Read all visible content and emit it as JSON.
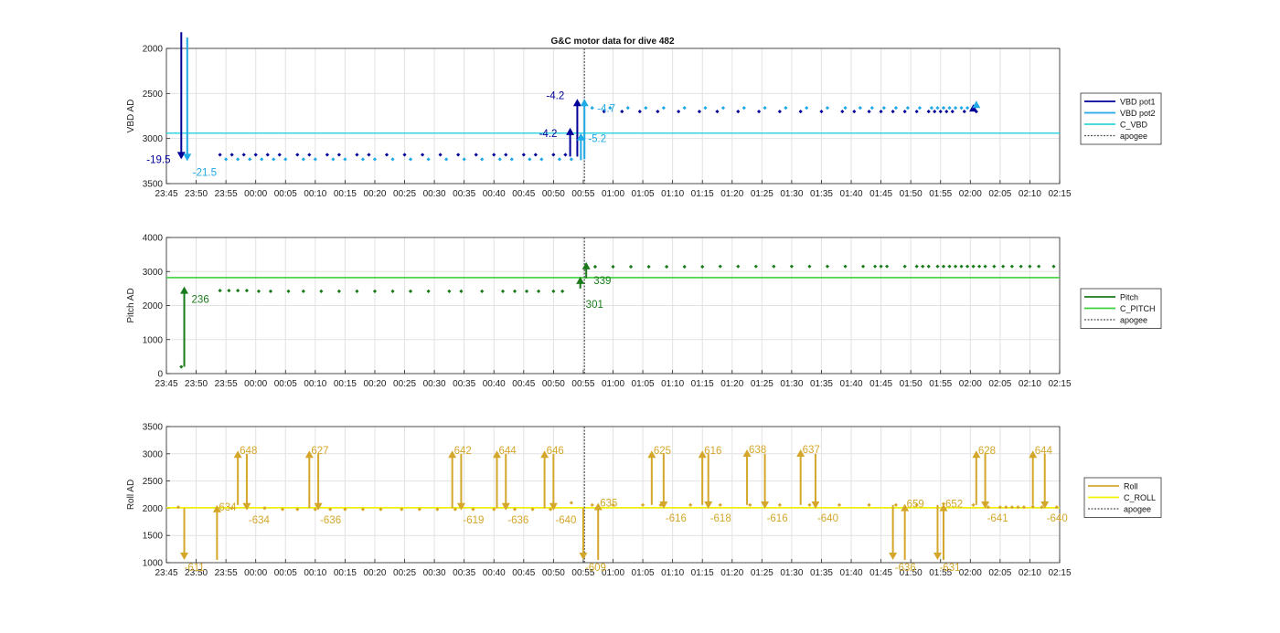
{
  "figure": {
    "title": "G&C motor data for dive 482"
  },
  "colors": {
    "vbd_pot1": "#000099",
    "vbd_pot2": "#1fa9e6",
    "c_vbd": "#33d6e0",
    "pitch": "#1a7a1a",
    "c_pitch": "#3ed13e",
    "roll": "#d4a62a",
    "c_roll": "#f2f200",
    "apogee": "#555555",
    "grid": "#e2e2e2",
    "axis": "#262626"
  },
  "chart_data": [
    {
      "type": "scatter",
      "title": "G&C motor data for dive 482",
      "ylabel": "VBD AD",
      "ylim": [
        2000,
        3500
      ],
      "y_reversed": true,
      "y_ticks": [
        "2000",
        "2500",
        "3000",
        "3500"
      ],
      "x_ticks": [
        "23:45",
        "23:50",
        "23:55",
        "00:00",
        "00:05",
        "00:10",
        "00:15",
        "00:20",
        "00:25",
        "00:30",
        "00:35",
        "00:40",
        "00:45",
        "00:50",
        "00:55",
        "01:00",
        "01:05",
        "01:10",
        "01:15",
        "01:20",
        "01:25",
        "01:30",
        "01:35",
        "01:40",
        "01:45",
        "01:50",
        "01:55",
        "02:00",
        "02:05",
        "02:10",
        "02:15"
      ],
      "xlim_minutes": [
        0,
        150
      ],
      "grid": true,
      "legend_position": "right",
      "legend": [
        "VBD pot1",
        "VBD pot2",
        "C_VBD",
        "apogee"
      ],
      "c_value": 2940,
      "apogee_minutes": 70.2,
      "series": [
        {
          "name": "VBD pot1",
          "color_key": "vbd_pot1",
          "x": [
            9,
            11,
            13,
            15,
            17,
            19,
            22,
            24,
            27,
            29,
            32,
            34,
            37,
            40,
            43,
            46,
            49,
            52,
            55,
            57,
            60,
            62,
            65,
            67,
            73.5,
            76.5,
            79.5,
            82.5,
            86,
            89.5,
            92.5,
            96,
            99.5,
            103,
            106.5,
            110,
            113.5,
            115.5,
            118,
            120,
            122,
            124,
            126,
            128,
            129,
            130,
            131,
            132,
            134,
            136
          ],
          "y": [
            3180,
            3180,
            3180,
            3180,
            3180,
            3180,
            3180,
            3180,
            3180,
            3180,
            3180,
            3180,
            3180,
            3180,
            3180,
            3180,
            3180,
            3180,
            3180,
            3180,
            3180,
            3180,
            3180,
            3180,
            2700,
            2700,
            2700,
            2700,
            2700,
            2700,
            2700,
            2700,
            2700,
            2700,
            2700,
            2700,
            2700,
            2700,
            2700,
            2700,
            2700,
            2700,
            2700,
            2700,
            2700,
            2700,
            2700,
            2700,
            2700,
            2700
          ]
        },
        {
          "name": "VBD pot2",
          "color_key": "vbd_pot2",
          "x": [
            10,
            12,
            14,
            16,
            18,
            20,
            23,
            25,
            28,
            30,
            33,
            35,
            38,
            41,
            44,
            47,
            50,
            53,
            56,
            58,
            61,
            63,
            66,
            68,
            71.5,
            74.5,
            77.5,
            80.5,
            83.5,
            87,
            90.5,
            93.5,
            97,
            100.5,
            104,
            107.5,
            111,
            114,
            116.5,
            118.5,
            120.5,
            122.5,
            124.5,
            126.5,
            128.5,
            129.5,
            130.5,
            131.5,
            132.5,
            133.5,
            134.5
          ],
          "y": [
            3230,
            3230,
            3230,
            3230,
            3230,
            3230,
            3230,
            3230,
            3230,
            3230,
            3230,
            3230,
            3230,
            3230,
            3230,
            3230,
            3230,
            3230,
            3230,
            3230,
            3230,
            3230,
            3230,
            3230,
            2660,
            2660,
            2660,
            2660,
            2660,
            2660,
            2660,
            2660,
            2660,
            2660,
            2660,
            2660,
            2660,
            2660,
            2660,
            2660,
            2660,
            2660,
            2660,
            2660,
            2660,
            2660,
            2660,
            2660,
            2660,
            2660,
            2660
          ]
        }
      ],
      "arrows": [
        {
          "color_key": "vbd_pot1",
          "x": 2.5,
          "y_from": 1820,
          "y_to": 3230,
          "label": "-19.5",
          "label_dx": -38,
          "label_dy": 4
        },
        {
          "color_key": "vbd_pot2",
          "x": 3.5,
          "y_from": 1880,
          "y_to": 3250,
          "label": "-21.5",
          "label_dx": 6,
          "label_dy": 16
        },
        {
          "color_key": "vbd_pot1",
          "x": 69.0,
          "y_from": 3200,
          "y_to": 2560,
          "label": "-4.2",
          "label_dx": -34,
          "label_dy": 0
        },
        {
          "color_key": "vbd_pot1",
          "x": 67.8,
          "y_from": 3200,
          "y_to": 2880,
          "label": "-4.2",
          "label_dx": -34,
          "label_dy": 10
        },
        {
          "color_key": "vbd_pot2",
          "x": 70.2,
          "y_from": 3230,
          "y_to": 2560,
          "label": "-4.7",
          "label_dx": 14,
          "label_dy": 14
        },
        {
          "color_key": "vbd_pot2",
          "x": 69.6,
          "y_from": 3240,
          "y_to": 2940,
          "label": "-5.2",
          "label_dx": 8,
          "label_dy": 10
        },
        {
          "color_key": "vbd_pot1",
          "x": 135.5,
          "y_from": 2680,
          "y_to": 2620,
          "label": "",
          "label_dx": 0,
          "label_dy": 0
        },
        {
          "color_key": "vbd_pot2",
          "x": 136.0,
          "y_from": 2640,
          "y_to": 2580,
          "label": "",
          "label_dx": 0,
          "label_dy": 0
        }
      ]
    },
    {
      "type": "scatter",
      "ylabel": "Pitch AD",
      "ylim": [
        0,
        4000
      ],
      "y_reversed": false,
      "y_ticks": [
        "0",
        "1000",
        "2000",
        "3000",
        "4000"
      ],
      "x_ticks": [
        "23:45",
        "23:50",
        "23:55",
        "00:00",
        "00:05",
        "00:10",
        "00:15",
        "00:20",
        "00:25",
        "00:30",
        "00:35",
        "00:40",
        "00:45",
        "00:50",
        "00:55",
        "01:00",
        "01:05",
        "01:10",
        "01:15",
        "01:20",
        "01:25",
        "01:30",
        "01:35",
        "01:40",
        "01:45",
        "01:50",
        "01:55",
        "02:00",
        "02:05",
        "02:10",
        "02:15"
      ],
      "xlim_minutes": [
        0,
        150
      ],
      "grid": true,
      "legend_position": "right",
      "legend": [
        "Pitch",
        "C_PITCH",
        "apogee"
      ],
      "c_value": 2820,
      "apogee_minutes": 70.2,
      "series": [
        {
          "name": "Pitch",
          "color_key": "pitch",
          "x": [
            2.5,
            9,
            10.5,
            12,
            13.5,
            15.5,
            17.5,
            20.5,
            23,
            26,
            29,
            32,
            35,
            38,
            41,
            44,
            47.5,
            49.5,
            53,
            56.5,
            58.5,
            60.5,
            62.5,
            65,
            66.5,
            72,
            75,
            78,
            81,
            84,
            87,
            90,
            93,
            96,
            99,
            102,
            105,
            108,
            111,
            114,
            117,
            119,
            120,
            121,
            124,
            126,
            127,
            128,
            129.5,
            130.5,
            131.5,
            132.5,
            133.5,
            134.5,
            135.5,
            136.5,
            137.5,
            139,
            140.5,
            142,
            143.5,
            145,
            146.5,
            149
          ],
          "y": [
            200,
            2440,
            2440,
            2440,
            2440,
            2420,
            2420,
            2420,
            2420,
            2420,
            2420,
            2420,
            2420,
            2420,
            2420,
            2420,
            2420,
            2420,
            2420,
            2420,
            2420,
            2420,
            2420,
            2420,
            2420,
            3140,
            3140,
            3140,
            3140,
            3140,
            3140,
            3140,
            3150,
            3150,
            3150,
            3150,
            3150,
            3150,
            3150,
            3150,
            3150,
            3150,
            3150,
            3150,
            3150,
            3150,
            3150,
            3150,
            3150,
            3150,
            3150,
            3150,
            3150,
            3150,
            3150,
            3150,
            3150,
            3150,
            3150,
            3150,
            3150,
            3150,
            3150,
            3150
          ]
        }
      ],
      "arrows": [
        {
          "color_key": "pitch",
          "x": 3.0,
          "y_from": 200,
          "y_to": 2560,
          "label": "236",
          "label_dx": 8,
          "label_dy": 18
        },
        {
          "color_key": "pitch",
          "x": 69.5,
          "y_from": 2500,
          "y_to": 2850,
          "label": "301",
          "label_dx": 6,
          "label_dy": 34
        },
        {
          "color_key": "pitch",
          "x": 70.5,
          "y_from": 2800,
          "y_to": 3280,
          "label": "339",
          "label_dx": 8,
          "label_dy": 24
        }
      ]
    },
    {
      "type": "scatter",
      "ylabel": "Roll AD",
      "ylim": [
        1000,
        3500
      ],
      "y_reversed": false,
      "y_ticks": [
        "1000",
        "1500",
        "2000",
        "2500",
        "3000",
        "3500"
      ],
      "x_ticks": [
        "23:45",
        "23:50",
        "23:55",
        "00:00",
        "00:05",
        "00:10",
        "00:15",
        "00:20",
        "00:25",
        "00:30",
        "00:35",
        "00:40",
        "00:45",
        "00:50",
        "00:55",
        "01:00",
        "01:05",
        "01:10",
        "01:15",
        "01:20",
        "01:25",
        "01:30",
        "01:35",
        "01:40",
        "01:45",
        "01:50",
        "01:55",
        "02:00",
        "02:05",
        "02:10",
        "02:15"
      ],
      "xlim_minutes": [
        0,
        150
      ],
      "grid": true,
      "legend_position": "right",
      "legend": [
        "Roll",
        "C_ROLL",
        "apogee"
      ],
      "c_value": 2010,
      "apogee_minutes": 70.2,
      "series": [
        {
          "name": "Roll",
          "color_key": "roll",
          "x": [
            2,
            11,
            16.5,
            19.5,
            22,
            25,
            27.5,
            30,
            33,
            36,
            39.5,
            42.5,
            45.5,
            48.5,
            51.5,
            55,
            58.5,
            61.5,
            64.5,
            68,
            71.5,
            75,
            80,
            83,
            88,
            93,
            98,
            103,
            108,
            113,
            118,
            122.5,
            126,
            130.5,
            135.5,
            138,
            140,
            141,
            142,
            143,
            144,
            145.5,
            147,
            149.5
          ],
          "y": [
            2020,
            2000,
            2000,
            1980,
            1980,
            1980,
            1980,
            1980,
            1980,
            1980,
            1980,
            1980,
            1980,
            1980,
            1980,
            1980,
            1980,
            1980,
            1980,
            2100,
            2060,
            2060,
            2060,
            2060,
            2060,
            2060,
            2060,
            2060,
            2060,
            2060,
            2060,
            2060,
            2060,
            2080,
            2060,
            2020,
            2020,
            2020,
            2020,
            2020,
            2020,
            2030,
            2020,
            2020
          ]
        }
      ],
      "arrows": [
        {
          "color_key": "roll",
          "x": 3.0,
          "y_from": 2000,
          "y_to": 1050,
          "label": "-611",
          "label_dx": 0,
          "label_dy": 12
        },
        {
          "color_key": "roll",
          "x": 8.5,
          "y_from": 1050,
          "y_to": 2060,
          "label": "634",
          "label_dx": 2,
          "label_dy": 6
        },
        {
          "color_key": "roll",
          "x": 12.0,
          "y_from": 2060,
          "y_to": 3060,
          "label": "648",
          "label_dx": 2,
          "label_dy": 4
        },
        {
          "color_key": "roll",
          "x": 13.5,
          "y_from": 3000,
          "y_to": 1960,
          "label": "-634",
          "label_dx": 2,
          "label_dy": 14
        },
        {
          "color_key": "roll",
          "x": 24.0,
          "y_from": 2000,
          "y_to": 3060,
          "label": "627",
          "label_dx": 2,
          "label_dy": 4
        },
        {
          "color_key": "roll",
          "x": 25.5,
          "y_from": 3000,
          "y_to": 1960,
          "label": "-636",
          "label_dx": 2,
          "label_dy": 14
        },
        {
          "color_key": "roll",
          "x": 48.0,
          "y_from": 2000,
          "y_to": 3060,
          "label": "642",
          "label_dx": 2,
          "label_dy": 4
        },
        {
          "color_key": "roll",
          "x": 49.5,
          "y_from": 3000,
          "y_to": 1960,
          "label": "-619",
          "label_dx": 2,
          "label_dy": 14
        },
        {
          "color_key": "roll",
          "x": 55.5,
          "y_from": 2000,
          "y_to": 3060,
          "label": "644",
          "label_dx": 2,
          "label_dy": 4
        },
        {
          "color_key": "roll",
          "x": 57.0,
          "y_from": 3000,
          "y_to": 1960,
          "label": "-636",
          "label_dx": 2,
          "label_dy": 14
        },
        {
          "color_key": "roll",
          "x": 63.5,
          "y_from": 2000,
          "y_to": 3060,
          "label": "646",
          "label_dx": 2,
          "label_dy": 4
        },
        {
          "color_key": "roll",
          "x": 65.0,
          "y_from": 3000,
          "y_to": 1960,
          "label": "-640",
          "label_dx": 2,
          "label_dy": 14
        },
        {
          "color_key": "roll",
          "x": 70.0,
          "y_from": 2000,
          "y_to": 1050,
          "label": "-609",
          "label_dx": 2,
          "label_dy": 12
        },
        {
          "color_key": "roll",
          "x": 72.5,
          "y_from": 1050,
          "y_to": 2100,
          "label": "635",
          "label_dx": 2,
          "label_dy": 4
        },
        {
          "color_key": "roll",
          "x": 81.5,
          "y_from": 2060,
          "y_to": 3060,
          "label": "625",
          "label_dx": 2,
          "label_dy": 4
        },
        {
          "color_key": "roll",
          "x": 83.5,
          "y_from": 3000,
          "y_to": 1990,
          "label": "-616",
          "label_dx": 2,
          "label_dy": 14
        },
        {
          "color_key": "roll",
          "x": 90.0,
          "y_from": 2060,
          "y_to": 3060,
          "label": "616",
          "label_dx": 2,
          "label_dy": 4
        },
        {
          "color_key": "roll",
          "x": 91.0,
          "y_from": 3000,
          "y_to": 1990,
          "label": "-618",
          "label_dx": 2,
          "label_dy": 14
        },
        {
          "color_key": "roll",
          "x": 97.5,
          "y_from": 2060,
          "y_to": 3080,
          "label": "638",
          "label_dx": 2,
          "label_dy": 4
        },
        {
          "color_key": "roll",
          "x": 100.5,
          "y_from": 3000,
          "y_to": 1990,
          "label": "-616",
          "label_dx": 2,
          "label_dy": 14
        },
        {
          "color_key": "roll",
          "x": 106.5,
          "y_from": 2060,
          "y_to": 3080,
          "label": "637",
          "label_dx": 2,
          "label_dy": 4
        },
        {
          "color_key": "roll",
          "x": 109.0,
          "y_from": 3000,
          "y_to": 1990,
          "label": "-640",
          "label_dx": 2,
          "label_dy": 14
        },
        {
          "color_key": "roll",
          "x": 122.0,
          "y_from": 2060,
          "y_to": 1050,
          "label": "-636",
          "label_dx": 2,
          "label_dy": 12
        },
        {
          "color_key": "roll",
          "x": 124.0,
          "y_from": 1050,
          "y_to": 2080,
          "label": "659",
          "label_dx": 2,
          "label_dy": 4
        },
        {
          "color_key": "roll",
          "x": 129.5,
          "y_from": 2060,
          "y_to": 1050,
          "label": "-631",
          "label_dx": 2,
          "label_dy": 12
        },
        {
          "color_key": "roll",
          "x": 130.5,
          "y_from": 1050,
          "y_to": 2080,
          "label": "652",
          "label_dx": 2,
          "label_dy": 4
        },
        {
          "color_key": "roll",
          "x": 136.0,
          "y_from": 2060,
          "y_to": 3060,
          "label": "628",
          "label_dx": 2,
          "label_dy": 4
        },
        {
          "color_key": "roll",
          "x": 137.5,
          "y_from": 3000,
          "y_to": 1990,
          "label": "-641",
          "label_dx": 2,
          "label_dy": 14
        },
        {
          "color_key": "roll",
          "x": 145.5,
          "y_from": 2060,
          "y_to": 3060,
          "label": "644",
          "label_dx": 2,
          "label_dy": 4
        },
        {
          "color_key": "roll",
          "x": 147.5,
          "y_from": 3000,
          "y_to": 1990,
          "label": "-640",
          "label_dx": 2,
          "label_dy": 14
        }
      ]
    }
  ]
}
